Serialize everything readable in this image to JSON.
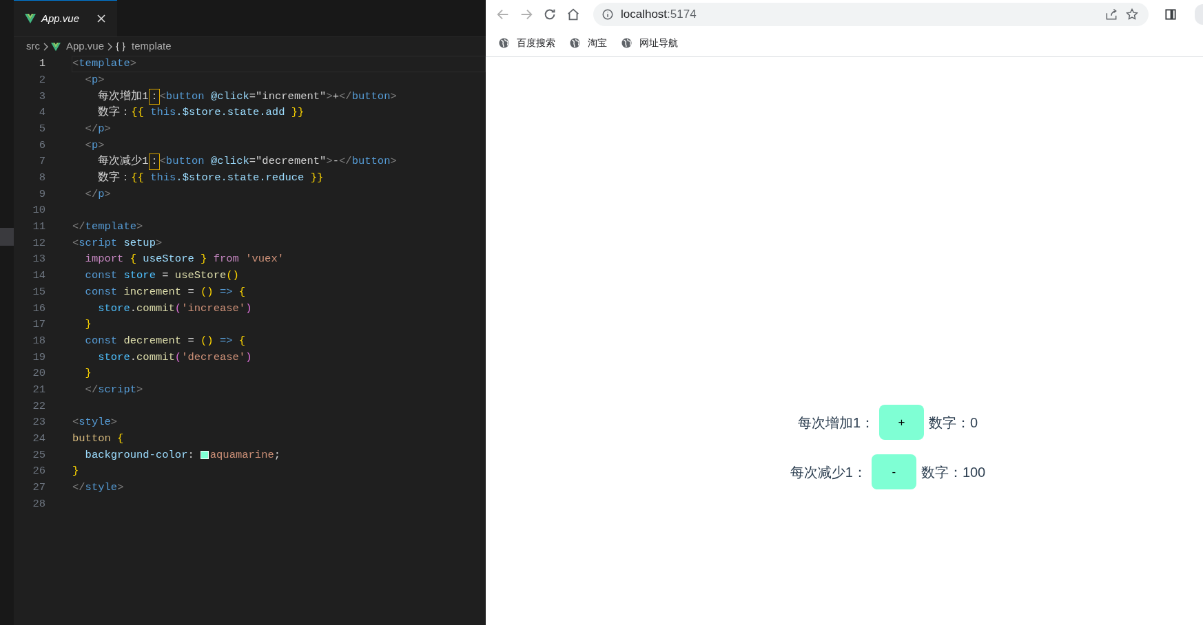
{
  "editor": {
    "tab": {
      "label": "App.vue",
      "selected": true
    },
    "breadcrumb": [
      "src",
      "App.vue",
      "template"
    ],
    "lines": [
      {
        "number": "1",
        "current": true,
        "tokens": [
          {
            "kind": "punct",
            "t": "<"
          },
          {
            "kind": "tag",
            "t": "template"
          },
          {
            "kind": "punct",
            "t": ">"
          }
        ]
      },
      {
        "number": "2",
        "current": false,
        "tokens": [
          {
            "kind": "punct",
            "t": "  <"
          },
          {
            "kind": "tag",
            "t": "p"
          },
          {
            "kind": "punct",
            "t": ">"
          }
        ]
      },
      {
        "number": "3",
        "current": false,
        "tokens": [
          {
            "kind": "text",
            "t": "    每次增加1"
          },
          {
            "kind": "text",
            "t": "：",
            "highlighted": true
          },
          {
            "kind": "punct",
            "t": "<"
          },
          {
            "kind": "tag",
            "t": "button"
          },
          {
            "kind": "attr",
            "t": " @click"
          },
          {
            "kind": "text",
            "t": "=\"increment\""
          },
          {
            "kind": "punct",
            "t": ">"
          },
          {
            "kind": "text",
            "t": "+"
          },
          {
            "kind": "punct",
            "t": "</"
          },
          {
            "kind": "tag",
            "t": "button"
          },
          {
            "kind": "punct",
            "t": ">"
          }
        ]
      },
      {
        "number": "4",
        "current": false,
        "tokens": [
          {
            "kind": "text",
            "t": "    数字："
          },
          {
            "kind": "bracket",
            "t": "{{"
          },
          {
            "kind": "keyword",
            "t": " this"
          },
          {
            "kind": "variable",
            "t": ".$store.state.add"
          },
          {
            "kind": "bracket",
            "t": " }}"
          }
        ]
      },
      {
        "number": "5",
        "current": false,
        "tokens": [
          {
            "kind": "punct",
            "t": "  </"
          },
          {
            "kind": "tag",
            "t": "p"
          },
          {
            "kind": "punct",
            "t": ">"
          }
        ]
      },
      {
        "number": "6",
        "current": false,
        "tokens": [
          {
            "kind": "punct",
            "t": "  <"
          },
          {
            "kind": "tag",
            "t": "p"
          },
          {
            "kind": "punct",
            "t": ">"
          }
        ]
      },
      {
        "number": "7",
        "current": false,
        "tokens": [
          {
            "kind": "text",
            "t": "    每次减少1"
          },
          {
            "kind": "text",
            "t": "：",
            "highlighted": true
          },
          {
            "kind": "punct",
            "t": "<"
          },
          {
            "kind": "tag",
            "t": "button"
          },
          {
            "kind": "attr",
            "t": " @click"
          },
          {
            "kind": "text",
            "t": "=\"decrement\""
          },
          {
            "kind": "punct",
            "t": ">"
          },
          {
            "kind": "text",
            "t": "-"
          },
          {
            "kind": "punct",
            "t": "</"
          },
          {
            "kind": "tag",
            "t": "button"
          },
          {
            "kind": "punct",
            "t": ">"
          }
        ]
      },
      {
        "number": "8",
        "current": false,
        "tokens": [
          {
            "kind": "text",
            "t": "    数字："
          },
          {
            "kind": "bracket",
            "t": "{{"
          },
          {
            "kind": "keyword",
            "t": " this"
          },
          {
            "kind": "variable",
            "t": ".$store.state.reduce"
          },
          {
            "kind": "bracket",
            "t": " }}"
          }
        ]
      },
      {
        "number": "9",
        "current": false,
        "tokens": [
          {
            "kind": "punct",
            "t": "  </"
          },
          {
            "kind": "tag",
            "t": "p"
          },
          {
            "kind": "punct",
            "t": ">"
          }
        ]
      },
      {
        "number": "10",
        "current": false
      },
      {
        "number": "11",
        "current": false,
        "tokens": [
          {
            "kind": "punct",
            "t": "</"
          },
          {
            "kind": "tag",
            "t": "template"
          },
          {
            "kind": "punct",
            "t": ">"
          }
        ]
      },
      {
        "number": "12",
        "current": false,
        "tokens": [
          {
            "kind": "punct",
            "t": "<"
          },
          {
            "kind": "tag",
            "t": "script"
          },
          {
            "kind": "attr",
            "t": " setup"
          },
          {
            "kind": "punct",
            "t": ">"
          }
        ]
      },
      {
        "number": "13",
        "current": false,
        "tokens": [
          {
            "kind": "control",
            "t": "  import"
          },
          {
            "kind": "bracket",
            "t": " {"
          },
          {
            "kind": "variable",
            "t": " useStore "
          },
          {
            "kind": "bracket",
            "t": "}"
          },
          {
            "kind": "control",
            "t": " from"
          },
          {
            "kind": "string",
            "t": " 'vuex'"
          }
        ]
      },
      {
        "number": "14",
        "current": false,
        "tokens": [
          {
            "kind": "keyword",
            "t": "  const"
          },
          {
            "kind": "constant",
            "t": " store"
          },
          {
            "kind": "text",
            "t": " = "
          },
          {
            "kind": "function",
            "t": "useStore"
          },
          {
            "kind": "bracket",
            "t": "()"
          }
        ]
      },
      {
        "number": "15",
        "current": false,
        "tokens": [
          {
            "kind": "keyword",
            "t": "  const"
          },
          {
            "kind": "function",
            "t": " increment"
          },
          {
            "kind": "text",
            "t": " = "
          },
          {
            "kind": "bracket",
            "t": "()"
          },
          {
            "kind": "keyword",
            "t": " =>"
          },
          {
            "kind": "bracket",
            "t": " {"
          }
        ]
      },
      {
        "number": "16",
        "current": false,
        "tokens": [
          {
            "kind": "constant",
            "t": "    store"
          },
          {
            "kind": "text",
            "t": "."
          },
          {
            "kind": "function",
            "t": "commit"
          },
          {
            "kind": "paren",
            "t": "("
          },
          {
            "kind": "string",
            "t": "'increase'"
          },
          {
            "kind": "paren",
            "t": ")"
          }
        ]
      },
      {
        "number": "17",
        "current": false,
        "tokens": [
          {
            "kind": "bracket",
            "t": "  }"
          }
        ]
      },
      {
        "number": "18",
        "current": false,
        "tokens": [
          {
            "kind": "keyword",
            "t": "  const"
          },
          {
            "kind": "function",
            "t": " decrement"
          },
          {
            "kind": "text",
            "t": " = "
          },
          {
            "kind": "bracket",
            "t": "()"
          },
          {
            "kind": "keyword",
            "t": " =>"
          },
          {
            "kind": "bracket",
            "t": " {"
          }
        ]
      },
      {
        "number": "19",
        "current": false,
        "tokens": [
          {
            "kind": "constant",
            "t": "    store"
          },
          {
            "kind": "text",
            "t": "."
          },
          {
            "kind": "function",
            "t": "commit"
          },
          {
            "kind": "paren",
            "t": "("
          },
          {
            "kind": "string",
            "t": "'decrease'"
          },
          {
            "kind": "paren",
            "t": ")"
          }
        ]
      },
      {
        "number": "20",
        "current": false,
        "tokens": [
          {
            "kind": "bracket",
            "t": "  }"
          }
        ]
      },
      {
        "number": "21",
        "current": false,
        "tokens": [
          {
            "kind": "punct",
            "t": "  </"
          },
          {
            "kind": "tag",
            "t": "script"
          },
          {
            "kind": "punct",
            "t": ">"
          }
        ]
      },
      {
        "number": "22",
        "current": false
      },
      {
        "number": "23",
        "current": false,
        "tokens": [
          {
            "kind": "punct",
            "t": "<"
          },
          {
            "kind": "tag",
            "t": "style"
          },
          {
            "kind": "punct",
            "t": ">"
          }
        ]
      },
      {
        "number": "24",
        "current": false,
        "tokens": [
          {
            "kind": "selector",
            "t": "button"
          },
          {
            "kind": "bracket",
            "t": " {"
          }
        ]
      },
      {
        "number": "25",
        "current": false,
        "tokens": [
          {
            "kind": "variable",
            "t": "  background-color"
          },
          {
            "kind": "text",
            "t": ":"
          },
          {
            "kind": "swatch",
            "color": "#7fffd4"
          },
          {
            "kind": "string",
            "t": "aquamarine"
          },
          {
            "kind": "text",
            "t": ";"
          }
        ]
      },
      {
        "number": "26",
        "current": false,
        "tokens": [
          {
            "kind": "bracket",
            "t": "}"
          }
        ]
      },
      {
        "number": "27",
        "current": false,
        "tokens": [
          {
            "kind": "punct",
            "t": "</"
          },
          {
            "kind": "tag",
            "t": "style"
          },
          {
            "kind": "punct",
            "t": ">"
          }
        ]
      },
      {
        "number": "28",
        "current": false
      }
    ]
  },
  "browser": {
    "address": {
      "host": "localhost",
      "port": ":5174"
    },
    "bookmarks": [
      "百度搜索",
      "淘宝",
      "网址导航"
    ],
    "rows": [
      {
        "label": "每次增加1：",
        "button": "+",
        "count": "数字：0"
      },
      {
        "label": "每次减少1：",
        "button": "-",
        "count": "数字：100"
      }
    ]
  }
}
